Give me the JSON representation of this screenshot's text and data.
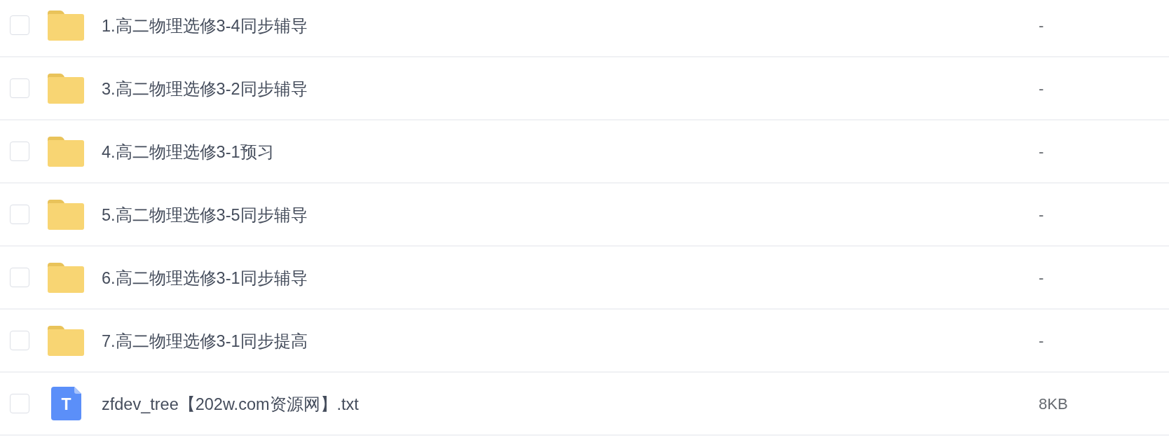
{
  "files": [
    {
      "kind": "folder",
      "name": "1.高二物理选修3-4同步辅导",
      "size": "-",
      "checked": false
    },
    {
      "kind": "folder",
      "name": "3.高二物理选修3-2同步辅导",
      "size": "-",
      "checked": false
    },
    {
      "kind": "folder",
      "name": "4.高二物理选修3-1预习",
      "size": "-",
      "checked": false
    },
    {
      "kind": "folder",
      "name": "5.高二物理选修3-5同步辅导",
      "size": "-",
      "checked": false
    },
    {
      "kind": "folder",
      "name": "6.高二物理选修3-1同步辅导",
      "size": "-",
      "checked": false
    },
    {
      "kind": "folder",
      "name": "7.高二物理选修3-1同步提高",
      "size": "-",
      "checked": false
    },
    {
      "kind": "text",
      "name": "zfdev_tree【202w.com资源网】.txt",
      "size": "8KB",
      "icon_letter": "T",
      "checked": false
    }
  ]
}
